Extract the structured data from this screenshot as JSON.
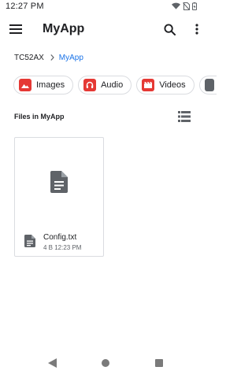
{
  "status_bar": {
    "time": "12:27 PM",
    "icons": [
      "wifi-icon",
      "no-sim-icon",
      "battery-icon"
    ]
  },
  "app_bar": {
    "title": "MyApp",
    "icons": [
      "menu-icon",
      "search-icon",
      "more-vert-icon"
    ]
  },
  "breadcrumb": {
    "items": [
      "TC52AX",
      "MyApp"
    ],
    "separator_icon": "chevron-right-icon"
  },
  "chips": [
    {
      "label": "Images",
      "icon": "image-icon"
    },
    {
      "label": "Audio",
      "icon": "headphones-icon"
    },
    {
      "label": "Videos",
      "icon": "movie-icon"
    },
    {
      "label": "",
      "icon": "document-icon"
    }
  ],
  "files_section": {
    "header": "Files in MyApp",
    "view_icon": "list-view-icon"
  },
  "files": [
    {
      "name": "Config.txt",
      "meta": "4 B 12:23 PM",
      "icon": "text-file-icon"
    }
  ],
  "colors": {
    "accent": "#1a73e8",
    "chip_icon": "#e53935",
    "icon_gray": "#5f6368"
  }
}
